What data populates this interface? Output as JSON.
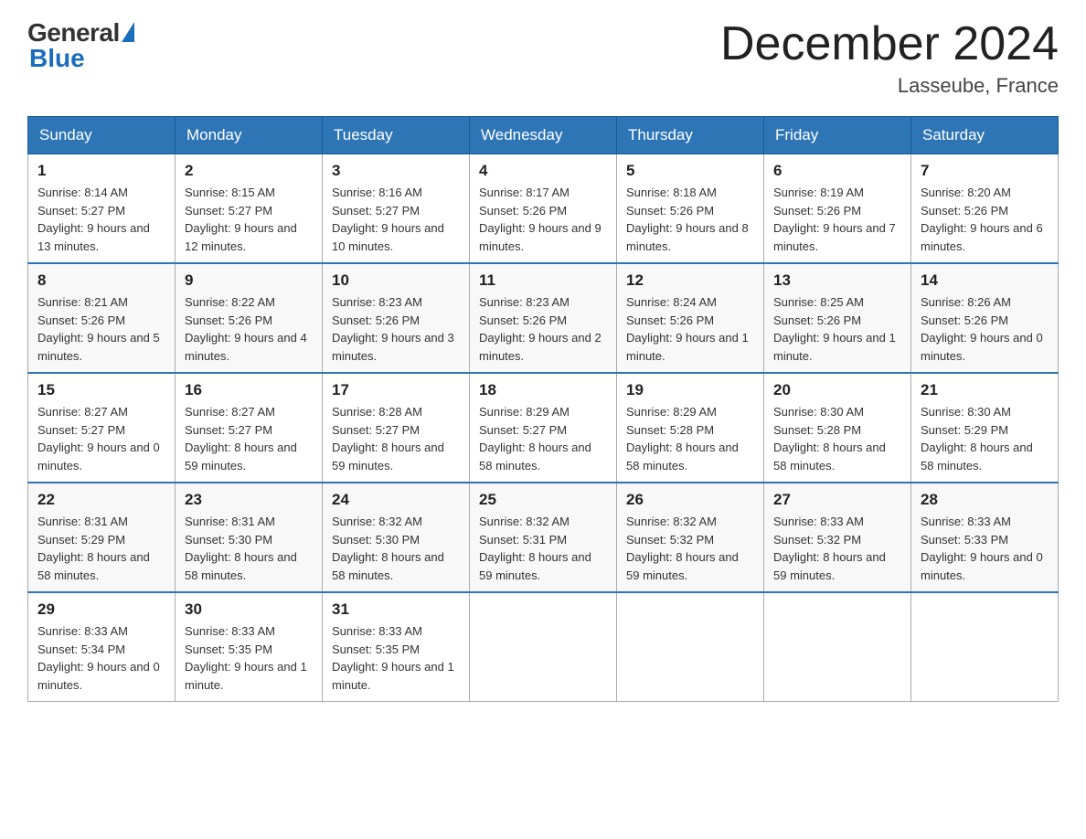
{
  "logo": {
    "general": "General",
    "blue": "Blue"
  },
  "title": "December 2024",
  "location": "Lasseube, France",
  "days_header": [
    "Sunday",
    "Monday",
    "Tuesday",
    "Wednesday",
    "Thursday",
    "Friday",
    "Saturday"
  ],
  "weeks": [
    [
      {
        "day": "1",
        "sunrise": "8:14 AM",
        "sunset": "5:27 PM",
        "daylight": "9 hours and 13 minutes."
      },
      {
        "day": "2",
        "sunrise": "8:15 AM",
        "sunset": "5:27 PM",
        "daylight": "9 hours and 12 minutes."
      },
      {
        "day": "3",
        "sunrise": "8:16 AM",
        "sunset": "5:27 PM",
        "daylight": "9 hours and 10 minutes."
      },
      {
        "day": "4",
        "sunrise": "8:17 AM",
        "sunset": "5:26 PM",
        "daylight": "9 hours and 9 minutes."
      },
      {
        "day": "5",
        "sunrise": "8:18 AM",
        "sunset": "5:26 PM",
        "daylight": "9 hours and 8 minutes."
      },
      {
        "day": "6",
        "sunrise": "8:19 AM",
        "sunset": "5:26 PM",
        "daylight": "9 hours and 7 minutes."
      },
      {
        "day": "7",
        "sunrise": "8:20 AM",
        "sunset": "5:26 PM",
        "daylight": "9 hours and 6 minutes."
      }
    ],
    [
      {
        "day": "8",
        "sunrise": "8:21 AM",
        "sunset": "5:26 PM",
        "daylight": "9 hours and 5 minutes."
      },
      {
        "day": "9",
        "sunrise": "8:22 AM",
        "sunset": "5:26 PM",
        "daylight": "9 hours and 4 minutes."
      },
      {
        "day": "10",
        "sunrise": "8:23 AM",
        "sunset": "5:26 PM",
        "daylight": "9 hours and 3 minutes."
      },
      {
        "day": "11",
        "sunrise": "8:23 AM",
        "sunset": "5:26 PM",
        "daylight": "9 hours and 2 minutes."
      },
      {
        "day": "12",
        "sunrise": "8:24 AM",
        "sunset": "5:26 PM",
        "daylight": "9 hours and 1 minute."
      },
      {
        "day": "13",
        "sunrise": "8:25 AM",
        "sunset": "5:26 PM",
        "daylight": "9 hours and 1 minute."
      },
      {
        "day": "14",
        "sunrise": "8:26 AM",
        "sunset": "5:26 PM",
        "daylight": "9 hours and 0 minutes."
      }
    ],
    [
      {
        "day": "15",
        "sunrise": "8:27 AM",
        "sunset": "5:27 PM",
        "daylight": "9 hours and 0 minutes."
      },
      {
        "day": "16",
        "sunrise": "8:27 AM",
        "sunset": "5:27 PM",
        "daylight": "8 hours and 59 minutes."
      },
      {
        "day": "17",
        "sunrise": "8:28 AM",
        "sunset": "5:27 PM",
        "daylight": "8 hours and 59 minutes."
      },
      {
        "day": "18",
        "sunrise": "8:29 AM",
        "sunset": "5:27 PM",
        "daylight": "8 hours and 58 minutes."
      },
      {
        "day": "19",
        "sunrise": "8:29 AM",
        "sunset": "5:28 PM",
        "daylight": "8 hours and 58 minutes."
      },
      {
        "day": "20",
        "sunrise": "8:30 AM",
        "sunset": "5:28 PM",
        "daylight": "8 hours and 58 minutes."
      },
      {
        "day": "21",
        "sunrise": "8:30 AM",
        "sunset": "5:29 PM",
        "daylight": "8 hours and 58 minutes."
      }
    ],
    [
      {
        "day": "22",
        "sunrise": "8:31 AM",
        "sunset": "5:29 PM",
        "daylight": "8 hours and 58 minutes."
      },
      {
        "day": "23",
        "sunrise": "8:31 AM",
        "sunset": "5:30 PM",
        "daylight": "8 hours and 58 minutes."
      },
      {
        "day": "24",
        "sunrise": "8:32 AM",
        "sunset": "5:30 PM",
        "daylight": "8 hours and 58 minutes."
      },
      {
        "day": "25",
        "sunrise": "8:32 AM",
        "sunset": "5:31 PM",
        "daylight": "8 hours and 59 minutes."
      },
      {
        "day": "26",
        "sunrise": "8:32 AM",
        "sunset": "5:32 PM",
        "daylight": "8 hours and 59 minutes."
      },
      {
        "day": "27",
        "sunrise": "8:33 AM",
        "sunset": "5:32 PM",
        "daylight": "8 hours and 59 minutes."
      },
      {
        "day": "28",
        "sunrise": "8:33 AM",
        "sunset": "5:33 PM",
        "daylight": "9 hours and 0 minutes."
      }
    ],
    [
      {
        "day": "29",
        "sunrise": "8:33 AM",
        "sunset": "5:34 PM",
        "daylight": "9 hours and 0 minutes."
      },
      {
        "day": "30",
        "sunrise": "8:33 AM",
        "sunset": "5:35 PM",
        "daylight": "9 hours and 1 minute."
      },
      {
        "day": "31",
        "sunrise": "8:33 AM",
        "sunset": "5:35 PM",
        "daylight": "9 hours and 1 minute."
      },
      null,
      null,
      null,
      null
    ]
  ]
}
